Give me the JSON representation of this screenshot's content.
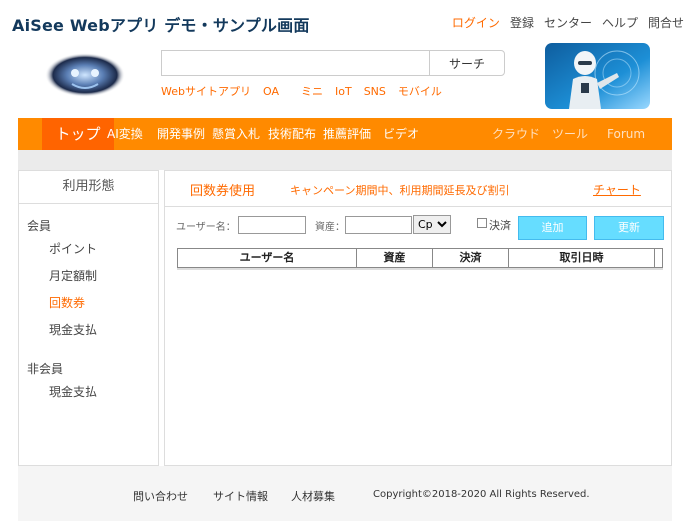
{
  "header": {
    "title": "AiSee Webアプリ デモ・サンプル画面",
    "links": [
      "ログイン",
      "登録",
      "センター",
      "ヘルプ",
      "問合せ"
    ]
  },
  "search": {
    "value": "",
    "placeholder": "",
    "button_label": "サーチ",
    "quick_links": [
      "Webサイトアプリ",
      "OA",
      "ミニ",
      "IoT",
      "SNS",
      "モバイル"
    ]
  },
  "nav": {
    "home": "トップ",
    "items": [
      "AI変換",
      "開発事例",
      "懸賞入札",
      "技術配布",
      "推薦評価",
      "ビデオ"
    ],
    "right_items": [
      "クラウド",
      "ツール",
      "Forum"
    ]
  },
  "sidebar": {
    "heading": "利用形態",
    "group1": "会員",
    "group1_items": [
      "ポイント",
      "月定額制",
      "回数券",
      "現金支払"
    ],
    "group2": "非会員",
    "group2_items": [
      "現金支払"
    ]
  },
  "main": {
    "title": "回数券使用",
    "notice": "キャンペーン期間中、利用期間延長及び割引",
    "chart_link": "チャート",
    "username_label": "ユーザー名：",
    "username_value": "",
    "asset_label": "資産：",
    "asset_value": "",
    "select_value": "Cp",
    "settled_label": "決済",
    "add_button": "追加",
    "refresh_button": "更新",
    "columns": [
      "ユーザー名",
      "資産",
      "決済",
      "取引日時"
    ]
  },
  "footer": {
    "links": [
      "問い合わせ",
      "サイト情報",
      "人材募集"
    ],
    "copyright": "Copyright©2018-2020 All Rights Reserved."
  },
  "colors": {
    "accent": "#ff6a00",
    "nav": "#ff8a00",
    "nav_home": "#ff6400",
    "button": "#66ddff",
    "title": "#13395c"
  }
}
